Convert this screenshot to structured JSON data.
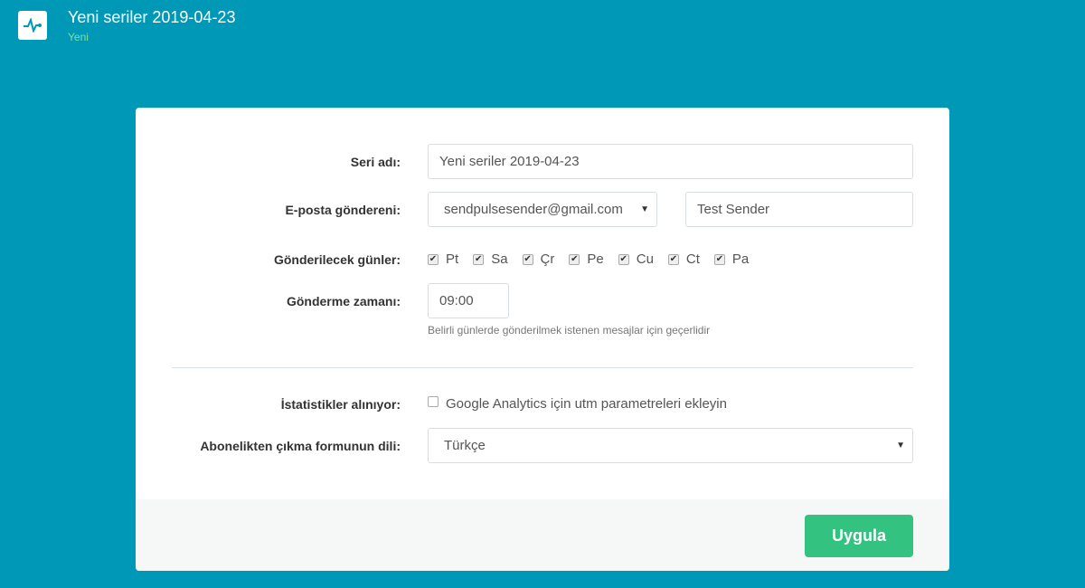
{
  "header": {
    "title": "Yeni seriler 2019-04-23",
    "subtitle": "Yeni",
    "icon": "pulse-icon"
  },
  "form": {
    "series_name_label": "Seri adı:",
    "series_name_value": "Yeni seriler 2019-04-23",
    "sender_label": "E-posta göndereni:",
    "sender_email": "sendpulsesender@gmail.com",
    "sender_name": "Test Sender",
    "days_label": "Gönderilecek günler:",
    "days": [
      {
        "label": "Pt",
        "checked": true
      },
      {
        "label": "Sa",
        "checked": true
      },
      {
        "label": "Çr",
        "checked": true
      },
      {
        "label": "Pe",
        "checked": true
      },
      {
        "label": "Cu",
        "checked": true
      },
      {
        "label": "Ct",
        "checked": true
      },
      {
        "label": "Pa",
        "checked": true
      }
    ],
    "time_label": "Gönderme zamanı:",
    "time_value": "09:00",
    "time_hint": "Belirli günlerde gönderilmek istenen mesajlar için geçerlidir",
    "stats_label": "İstatistikler alınıyor:",
    "stats_checkbox": "Google Analytics için utm parametreleri ekleyin",
    "stats_checked": false,
    "unsub_label": "Abonelikten çıkma formunun dili:",
    "unsub_value": "Türkçe"
  },
  "footer": {
    "apply": "Uygula"
  }
}
